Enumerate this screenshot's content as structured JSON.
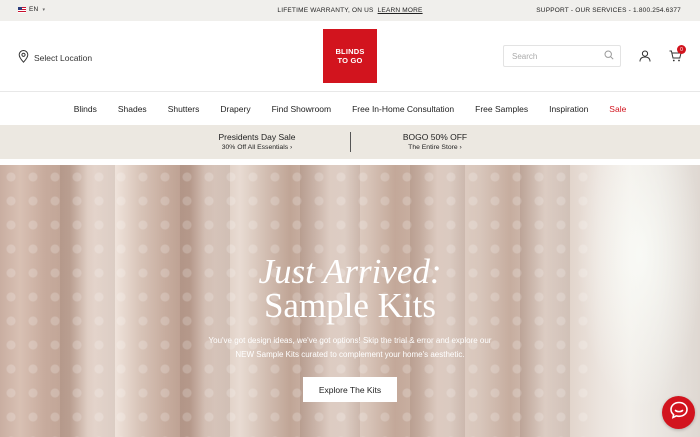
{
  "topbar": {
    "language": "EN",
    "warranty_text": "LIFETIME WARRANTY, ON US",
    "warranty_link": "LEARN MORE",
    "support": "SUPPORT - OUR SERVICES - 1.800.254.6377"
  },
  "header": {
    "location_label": "Select Location",
    "logo_line1": "BLINDS",
    "logo_line2": "TO GO",
    "search_placeholder": "Search",
    "cart_count": "0"
  },
  "nav": {
    "items": [
      "Blinds",
      "Shades",
      "Shutters",
      "Drapery",
      "Find Showroom",
      "Free In-Home Consultation",
      "Free Samples",
      "Inspiration",
      "Sale"
    ]
  },
  "promo": [
    {
      "title": "Presidents Day Sale",
      "subtitle": "30% Off All Essentials ›"
    },
    {
      "title": "BOGO 50% OFF",
      "subtitle": "The Entire Store ›"
    }
  ],
  "hero": {
    "title_line1": "Just Arrived:",
    "title_line2": "Sample Kits",
    "description": "You've got design ideas, we've got options! Skip the trial & error and explore our NEW Sample Kits curated to complement your home's aesthetic.",
    "button_label": "Explore The Kits"
  },
  "colors": {
    "brand_red": "#d2141e",
    "promo_bg": "#ece8e1",
    "topbar_bg": "#f0efec"
  },
  "icons": [
    "us-flag-icon",
    "chevron-down-icon",
    "location-pin-icon",
    "search-icon",
    "user-icon",
    "cart-icon",
    "chat-icon"
  ]
}
